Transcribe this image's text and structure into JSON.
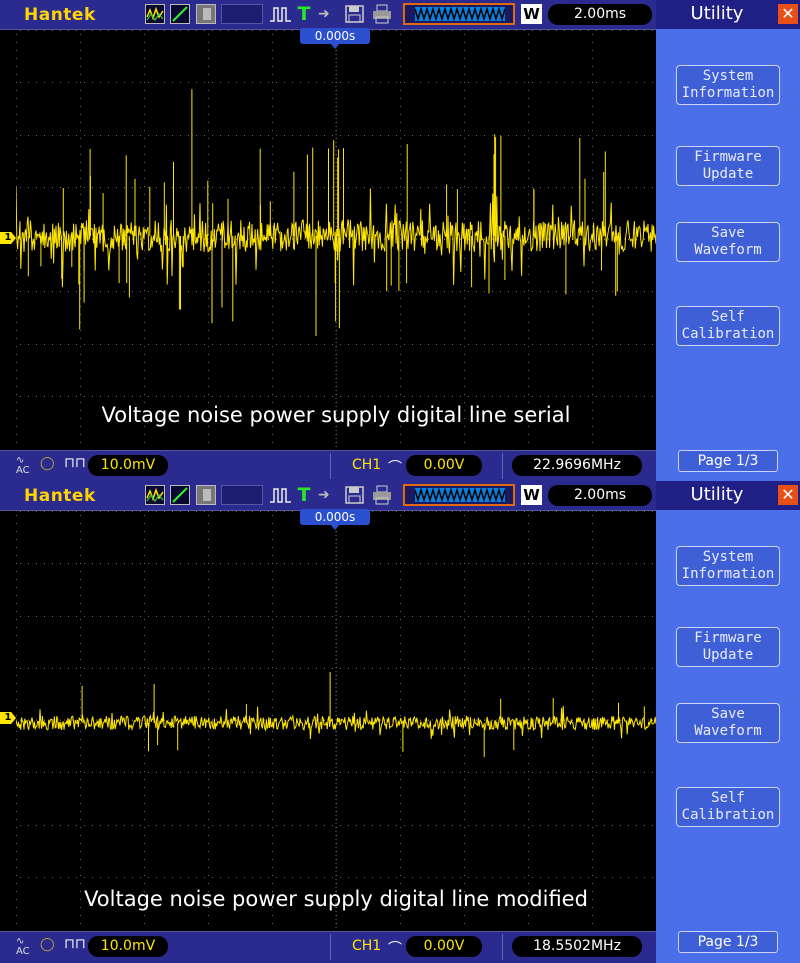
{
  "screens": [
    {
      "brand": "Hantek",
      "timebase": "2.00ms",
      "trigger_position": "0.000s",
      "channel_marker": "1",
      "caption": "Voltage noise power supply digital line serial",
      "volts_div": "10.0mV",
      "trigger_channel": "CH1",
      "trigger_level": "0.00V",
      "frequency": "22.9696MHz",
      "trace_color": "#ffe600",
      "noise_level": "high",
      "menu": {
        "title": "Utility",
        "items": [
          {
            "line1": "System",
            "line2": "Information"
          },
          {
            "line1": "Firmware",
            "line2": "Update"
          },
          {
            "line1": "Save",
            "line2": "Waveform"
          },
          {
            "line1": "Self",
            "line2": "Calibration"
          }
        ],
        "page": "Page 1/3"
      }
    },
    {
      "brand": "Hantek",
      "timebase": "2.00ms",
      "trigger_position": "0.000s",
      "channel_marker": "1",
      "caption": "Voltage noise power supply digital line modified",
      "volts_div": "10.0mV",
      "trigger_channel": "CH1",
      "trigger_level": "0.00V",
      "frequency": "18.5502MHz",
      "trace_color": "#ffe600",
      "noise_level": "low",
      "menu": {
        "title": "Utility",
        "items": [
          {
            "line1": "System",
            "line2": "Information"
          },
          {
            "line1": "Firmware",
            "line2": "Update"
          },
          {
            "line1": "Save",
            "line2": "Waveform"
          },
          {
            "line1": "Self",
            "line2": "Calibration"
          }
        ],
        "page": "Page 1/3"
      }
    }
  ],
  "colors": {
    "bar_bg": "#2b2b8f",
    "menu_bg": "#4a6fe8",
    "trace": "#ffe600",
    "brand": "#ffd400",
    "close": "#e8501a"
  }
}
